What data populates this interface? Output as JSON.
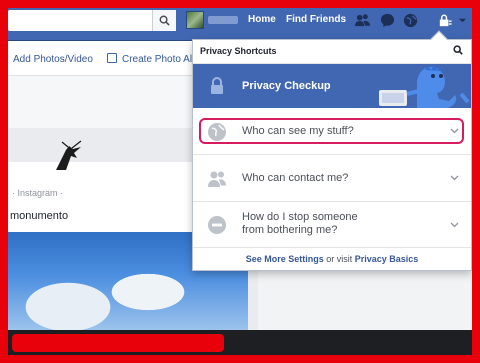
{
  "topbar": {
    "search_icon": "search-icon",
    "links": [
      "Home",
      "Find Friends"
    ],
    "icons": [
      "friends-icon",
      "messages-icon",
      "globe-notifications-icon",
      "privacy-lock-icon",
      "caret-down-icon"
    ]
  },
  "composer": {
    "add_photos_label": "Add Photos/Video",
    "create_album_label": "Create Photo Alb"
  },
  "post": {
    "meta": "· Instagram · ",
    "text": "monumento"
  },
  "privacy": {
    "header": "Privacy Shortcuts",
    "checkup": "Privacy Checkup",
    "items": [
      {
        "label": "Who can see my stuff?",
        "icon": "globe-icon"
      },
      {
        "label": "Who can contact me?",
        "icon": "people-icon"
      },
      {
        "label_line1": "How do I stop someone",
        "label_line2": "from bothering me?",
        "icon": "block-icon"
      }
    ],
    "footer_see_more": "See More Settings",
    "footer_mid": " or visit ",
    "footer_basics": "Privacy Basics"
  },
  "colors": {
    "brand_blue": "#4267b2",
    "highlight": "#d81a5e",
    "frame_red": "#e8000b"
  }
}
